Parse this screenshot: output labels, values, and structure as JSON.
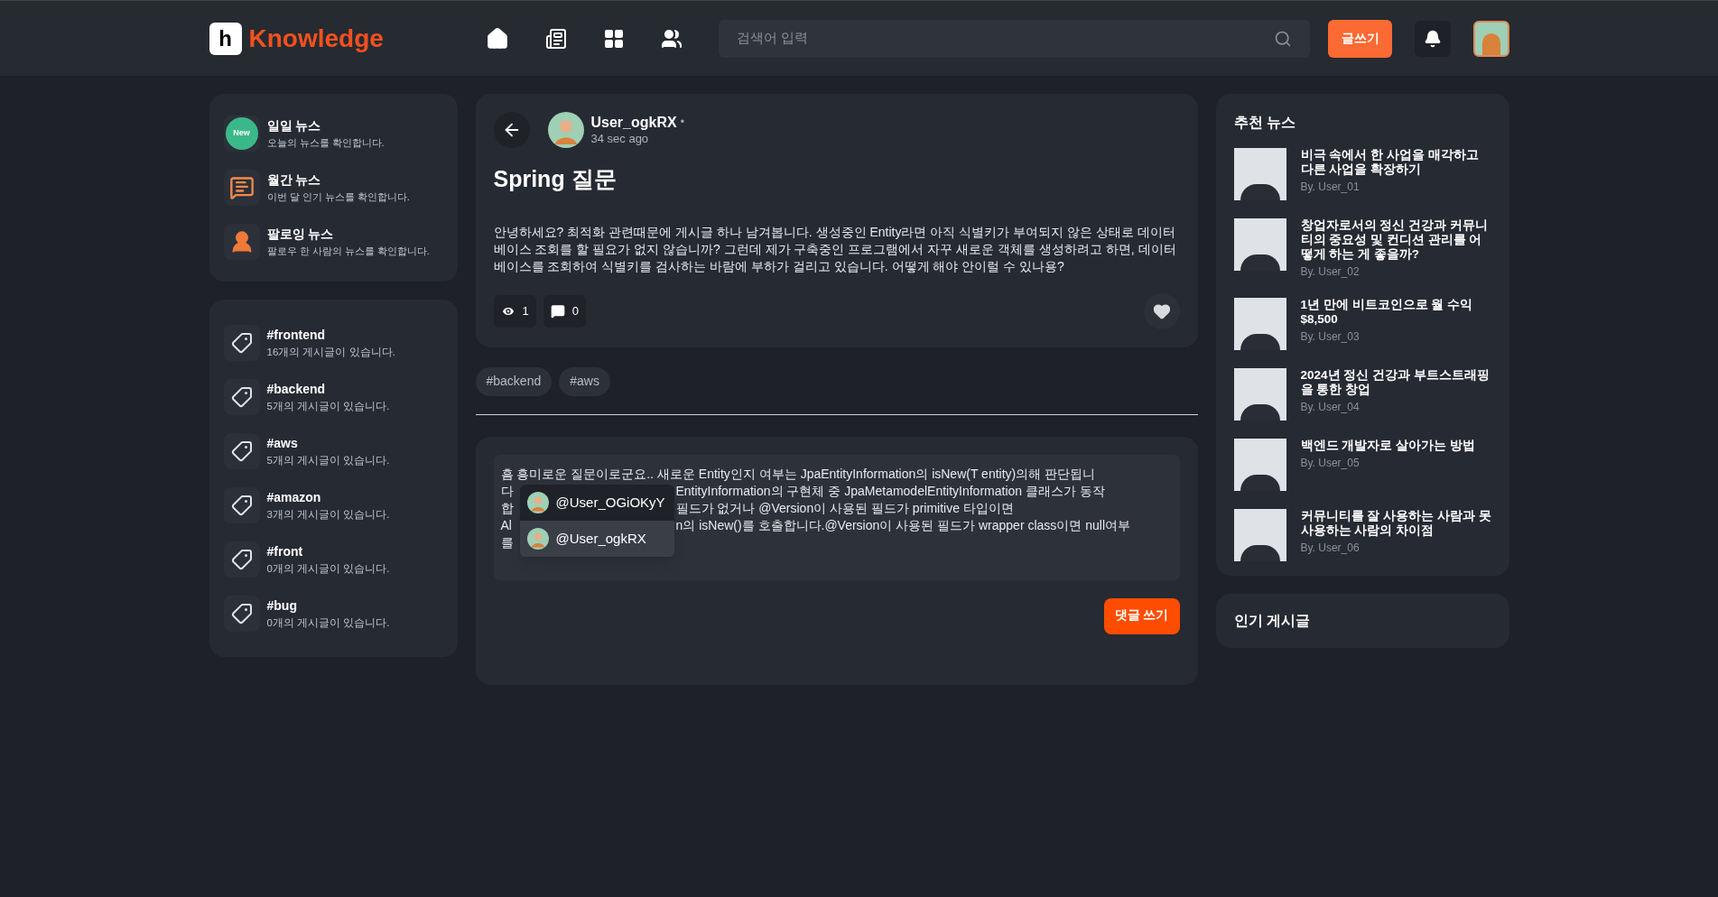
{
  "header": {
    "logo_mark": "h",
    "logo_text": "Knowledge",
    "search": {
      "placeholder": "검색어 입력"
    },
    "write_button": "글쓰기"
  },
  "sidebar": {
    "news_menu": [
      {
        "title": "일일 뉴스",
        "description": "오늘의 뉴스를 확인합니다.",
        "badge": "New"
      },
      {
        "title": "월간 뉴스",
        "description": "이번 달 인기 뉴스를 확인합니다."
      },
      {
        "title": "팔로잉 뉴스",
        "description": "팔로우 한 사람의 뉴스를 확인합니다."
      }
    ],
    "tags": [
      {
        "name": "#frontend",
        "count": "16개의 게시글이 있습니다."
      },
      {
        "name": "#backend",
        "count": "5개의 게시글이 있습니다."
      },
      {
        "name": "#aws",
        "count": "5개의 게시글이 있습니다."
      },
      {
        "name": "#amazon",
        "count": "3개의 게시글이 있습니다."
      },
      {
        "name": "#front",
        "count": "0개의 게시글이 있습니다."
      },
      {
        "name": "#bug",
        "count": "0개의 게시글이 있습니다."
      }
    ]
  },
  "post": {
    "author": "User_ogkRX",
    "separator": "•",
    "time": "34 sec ago",
    "title": "Spring 질문",
    "body": "안녕하세요? 최적화 관련때문에 게시글 하나 남겨봅니다. 생성중인 Entity라면 아직 식별키가 부여되지 않은 상태로 데이터베이스 조회를 할 필요가 없지 않습니까? 그런데 제가 구축중인 프로그램에서 자꾸 새로운 객체를 생성하려고 하면, 데이터베이스를 조회하여 식별키를 검사하는 바람에 부하가 걸리고 있습니다. 어떻게 해야 안이럴 수 있나용?",
    "views": "1",
    "comments": "0",
    "liked": false,
    "tags": [
      "#backend",
      "#aws"
    ]
  },
  "comment_box": {
    "lines": [
      {
        "left": "흠 흥미로운 질문이로군요.. 새로운 Entity인지 여부는 JpaEntityInformation의 isNew(T entity)의해 판단됩니"
      },
      {
        "left": "다",
        "right": "EntityInformation의 구현체 중 JpaMetamodelEntityInformation 클래스가 동작"
      },
      {
        "left": "합",
        "right": "필드가 없거나 @Version이 사용된 필드가 primitive 타입이면"
      },
      {
        "left": "Al",
        "right": "n의 isNew()를 호출합니다.@Version이 사용된 필드가 wrapper class이면 null여부"
      },
      {
        "left": "를"
      }
    ],
    "mentions": [
      {
        "user": "@User_OGiOKyY",
        "selected": true
      },
      {
        "user": "@User_ogkRX",
        "selected": false
      }
    ],
    "submit_button": "댓글 쓰기"
  },
  "recommended_news": {
    "title": "추천 뉴스",
    "items": [
      {
        "title": "비극 속에서 한 사업을 매각하고 다른 사업을 확장하기",
        "author": "By. User_01"
      },
      {
        "title": "창업자로서의 정신 건강과 커뮤니티의 중요성 및 컨디션 관리를 어떻게 하는 게 좋을까?",
        "author": "By. User_02"
      },
      {
        "title": "1년 만에 비트코인으로 월 수익 $8,500",
        "author": "By. User_03"
      },
      {
        "title": "2024년 정신 건강과 부트스트래핑을 통한 창업",
        "author": "By. User_04"
      },
      {
        "title": "백엔드 개발자로 살아가는 방법",
        "author": "By. User_05"
      },
      {
        "title": "커뮤니티를 잘 사용하는 사람과 못 사용하는 사람의 차이점",
        "author": "By. User_06"
      }
    ]
  },
  "popular_posts": {
    "title": "인기 게시글"
  }
}
